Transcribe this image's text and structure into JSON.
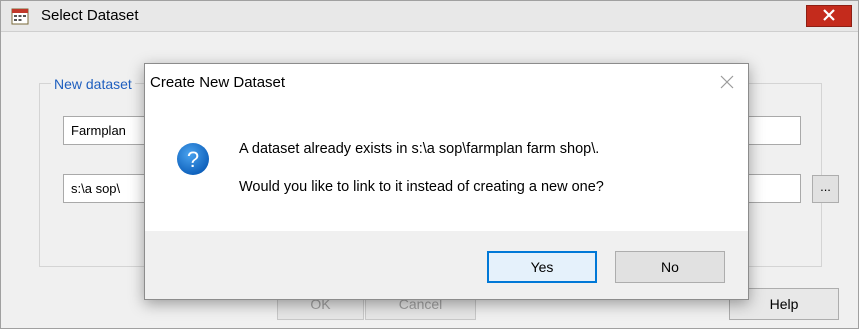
{
  "background_window": {
    "title": "Select Dataset",
    "legend": "New dataset",
    "name_value": "Farmplan",
    "path_value": "s:\\a sop\\",
    "browse_label": "...",
    "ok_label": "OK",
    "cancel_label": "Cancel",
    "help_label": "Help"
  },
  "dialog": {
    "title": "Create New Dataset",
    "line1": "A dataset already exists in s:\\a sop\\farmplan farm shop\\.",
    "line2": "Would you like to link to it instead of creating a new one?",
    "yes_label": "Yes",
    "no_label": "No",
    "icon": "question-icon"
  },
  "colors": {
    "accent": "#0078d7",
    "close_red": "#c42b1c",
    "legend_blue": "#1f5fbf"
  }
}
